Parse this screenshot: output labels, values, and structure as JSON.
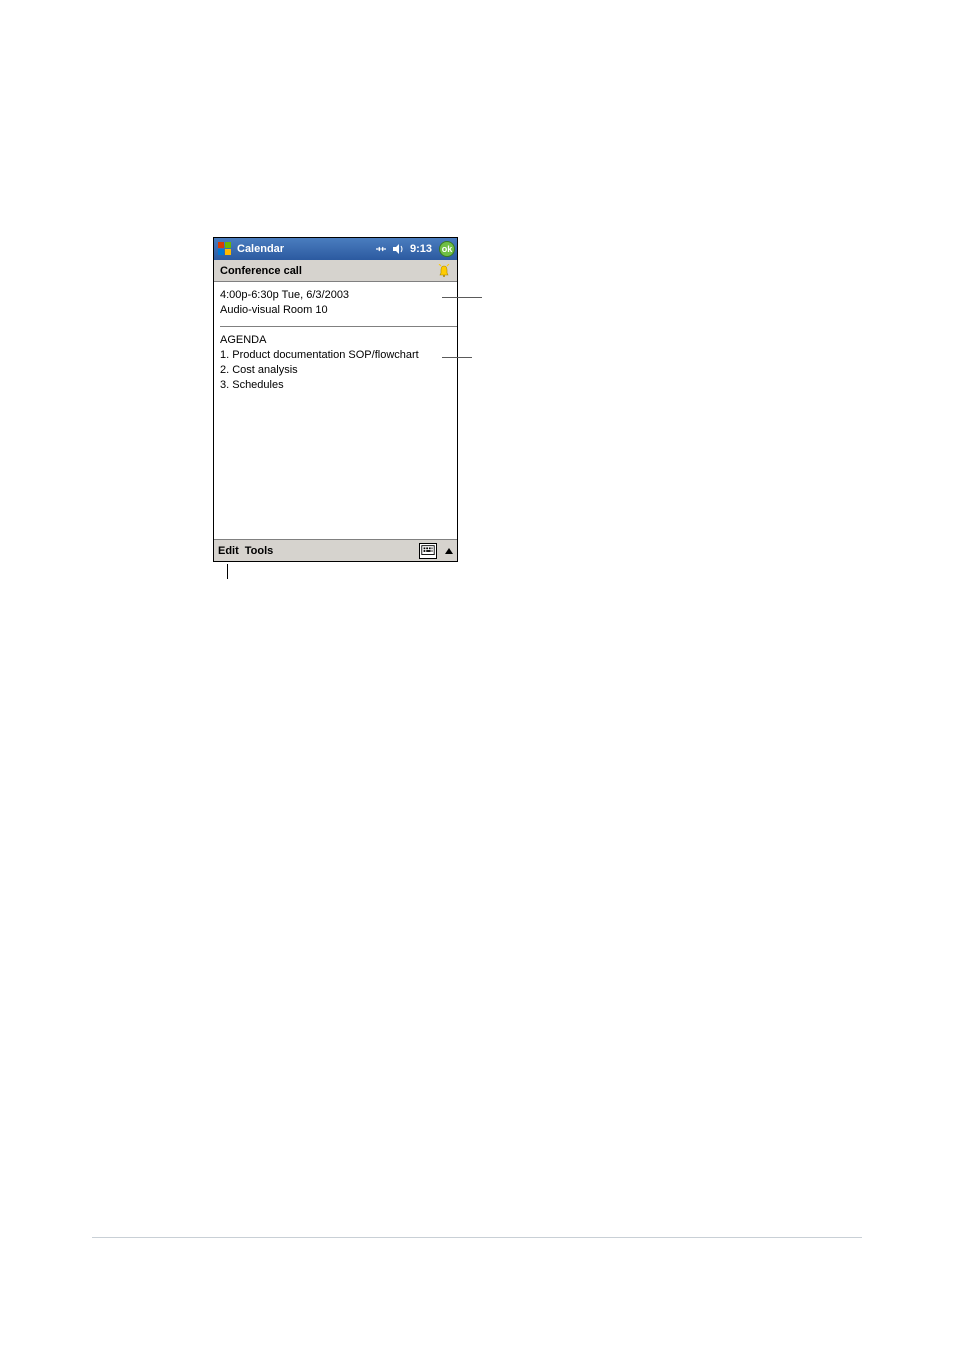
{
  "title_bar": {
    "app_name": "Calendar",
    "time": "9:13",
    "ok_label": "ok"
  },
  "subject": "Conference call",
  "meta": {
    "time_line": "4:00p-6:30p Tue, 6/3/2003",
    "location_line": "Audio-visual Room 10"
  },
  "notes": {
    "heading": "AGENDA",
    "items": [
      "1. Product documentation SOP/flowchart",
      "2. Cost analysis",
      "3. Schedules"
    ]
  },
  "bottom_bar": {
    "edit": "Edit",
    "tools": "Tools"
  }
}
